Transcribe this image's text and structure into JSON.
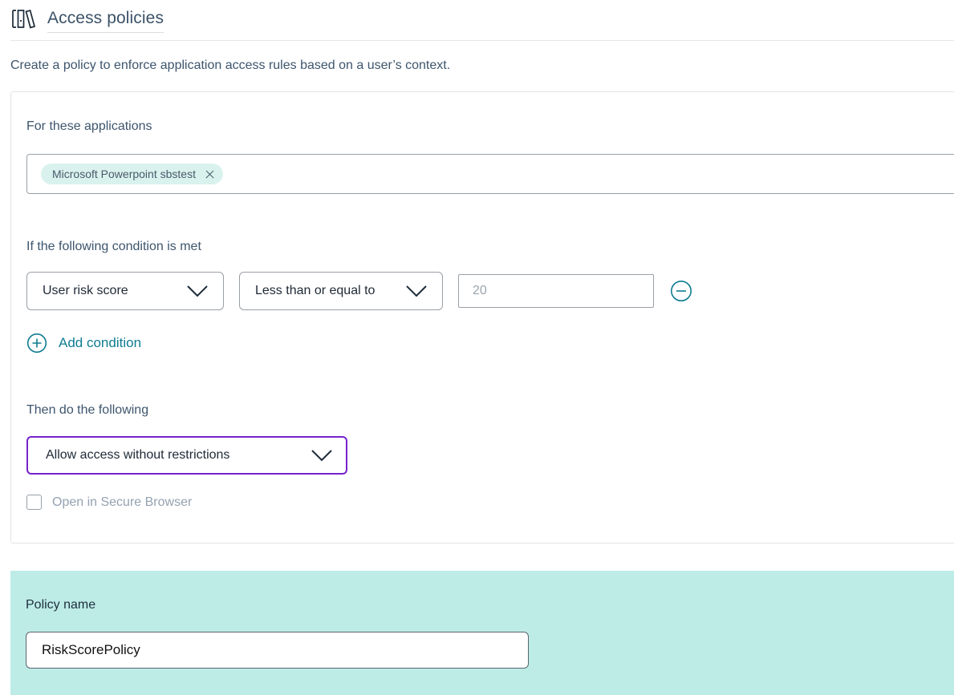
{
  "header": {
    "title": "Access policies",
    "icon": "books-icon"
  },
  "intro": {
    "text": "Create a policy to enforce application access rules based on a user’s context."
  },
  "applications": {
    "label": "For these applications",
    "chips": [
      {
        "label": "Microsoft Powerpoint sbstest",
        "remove_icon": "close-icon"
      }
    ]
  },
  "condition": {
    "label": "If the following condition is met",
    "attribute_value": "User risk score",
    "operator_value": "Less than or equal to",
    "value_placeholder": "20",
    "value_current": "",
    "remove_icon": "minus-circle-icon",
    "add_condition_label": "Add condition",
    "add_condition_icon": "plus-circle-icon",
    "chevron_icon": "chevron-down-icon"
  },
  "action": {
    "label": "Then do the following",
    "selected": "Allow access without restrictions",
    "chevron_icon": "chevron-down-icon",
    "secure_browser_label": "Open in Secure Browser",
    "secure_browser_checked": false
  },
  "policy_name": {
    "label": "Policy name",
    "value": "RiskScorePolicy"
  },
  "colors": {
    "accent_teal": "#0e7c91",
    "focus_purple": "#7722cc",
    "band_teal": "#bdece7",
    "chip_bg": "#d9f2ee",
    "title": "#3b5268"
  }
}
